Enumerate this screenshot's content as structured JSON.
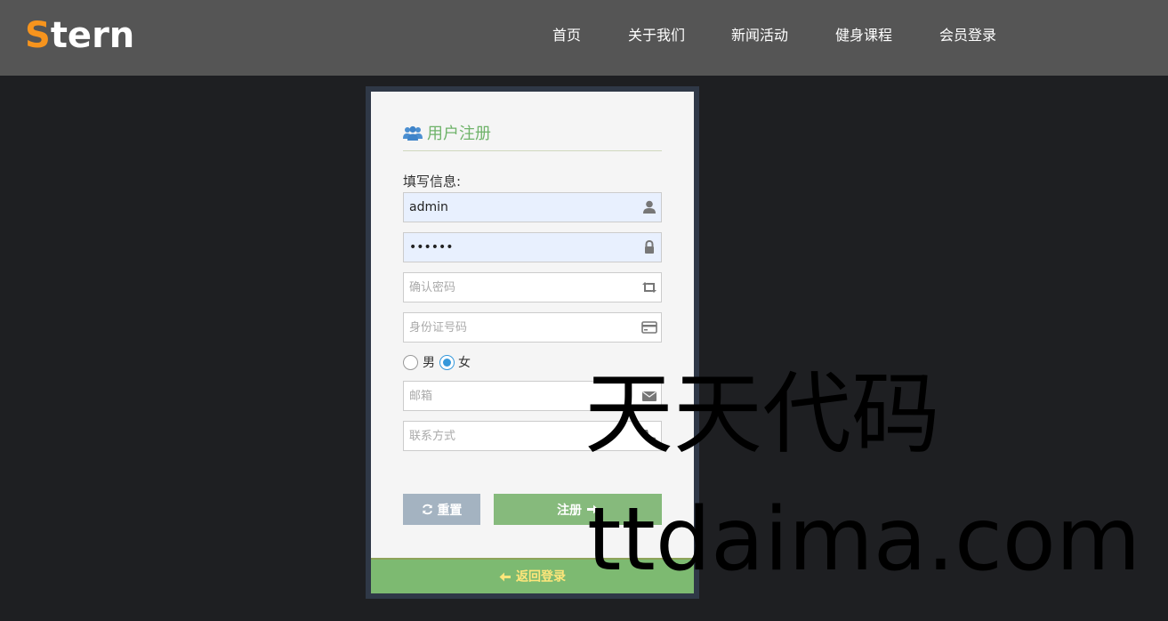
{
  "logo": {
    "first_letter": "S",
    "rest": "tern"
  },
  "nav": {
    "items": [
      "首页",
      "关于我们",
      "新闻活动",
      "健身课程",
      "会员登录"
    ]
  },
  "form": {
    "title": "用户注册",
    "title_icon": "users-icon",
    "section_label": "填写信息:",
    "fields": [
      {
        "value": "admin",
        "placeholder": "",
        "icon": "user-icon"
      },
      {
        "value": "123456",
        "placeholder": "",
        "icon": "lock-icon"
      },
      {
        "value": "",
        "placeholder": "确认密码",
        "icon": "retweet-icon"
      },
      {
        "value": "",
        "placeholder": "身份证号码",
        "icon": "credit-card-icon"
      },
      {
        "value": "",
        "placeholder": "邮箱",
        "icon": "envelope-icon"
      },
      {
        "value": "",
        "placeholder": "联系方式",
        "icon": "phone-icon"
      }
    ],
    "gender": {
      "options": [
        "男",
        "女"
      ],
      "selected": "女"
    },
    "reset_label": "重置",
    "submit_label": "注册",
    "back_label": "返回登录"
  },
  "watermark": {
    "line1": "天天代码",
    "line2": "ttdaima.com"
  },
  "colors": {
    "accent_orange": "#f7941d",
    "title_green": "#6fb36a",
    "submit_green": "#86ba7c",
    "reset_gray": "#a4b3c1",
    "back_bar": "#7dba71",
    "back_text": "#ffe67a",
    "radio_blue": "#3498db"
  }
}
